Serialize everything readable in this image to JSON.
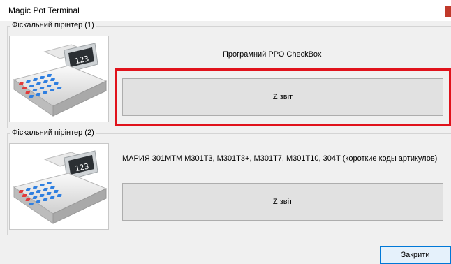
{
  "window": {
    "title": "Magic Pot Terminal"
  },
  "printer1": {
    "group_label": "Фіскальний пірінтер (1)",
    "device_name": "Програмний РРО CheckBox",
    "z_report_label": "Z звіт",
    "display_text": "123"
  },
  "printer2": {
    "group_label": "Фіскальний пірінтер (2)",
    "device_name": "МАРИЯ 301МТМ М301Т3, М301Т3+, М301Т7, М301Т10, 304Т  (короткие коды артикулов)",
    "z_report_label": "Z звіт",
    "display_text": "123"
  },
  "footer": {
    "close_label": "Закрити"
  },
  "colors": {
    "highlight": "#e0121b",
    "focus_border": "#0078d7",
    "keypad_blue": "#2f7fe0",
    "keypad_red": "#e23a3a"
  }
}
